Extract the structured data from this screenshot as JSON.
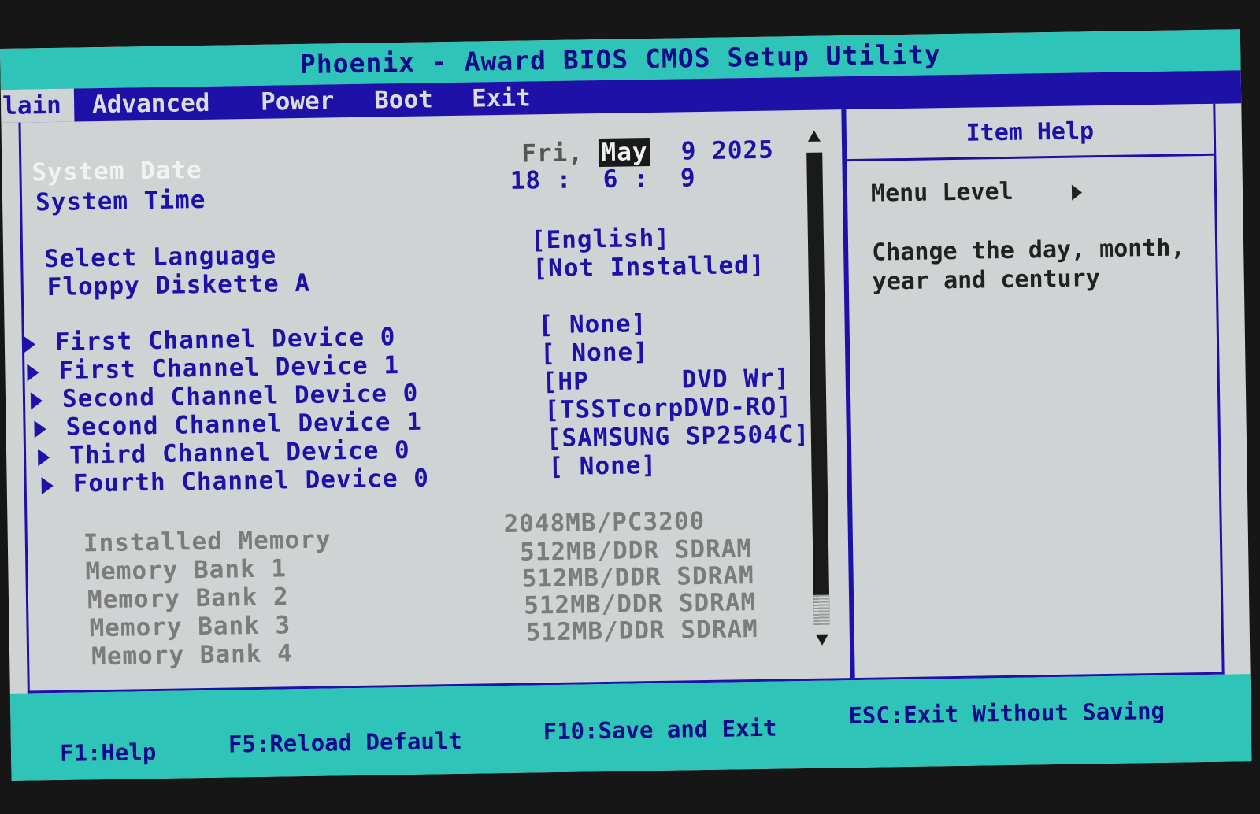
{
  "title": "Phoenix - Award BIOS CMOS Setup Utility",
  "menu": [
    "Main",
    "Advanced",
    "Power",
    "Boot",
    "Exit"
  ],
  "main_visible_label": "lain",
  "system_date": {
    "label": "System Date",
    "day": "Fri,",
    "month": "May",
    "date": "9",
    "year": "2025"
  },
  "system_time": {
    "label": "System Time",
    "value": "18 :  6 :  9"
  },
  "settings": [
    {
      "label": "Select Language",
      "value": "[English]"
    },
    {
      "label": "Floppy Diskette A",
      "value": "[Not Installed]"
    }
  ],
  "devices": [
    {
      "label": "First Channel Device 0",
      "value": "[ None]"
    },
    {
      "label": "First Channel Device 1",
      "value": "[ None]"
    },
    {
      "label": "Second Channel Device 0",
      "value": "[HP      DVD Wr]"
    },
    {
      "label": "Second Channel Device 1",
      "value": "[TSSTcorpDVD-RO]"
    },
    {
      "label": "Third Channel Device 0",
      "value": "[SAMSUNG SP2504C]"
    },
    {
      "label": "Fourth Channel Device 0",
      "value": "[ None]"
    }
  ],
  "memory": [
    {
      "label": "Installed Memory",
      "value": "2048MB/PC3200"
    },
    {
      "label": "Memory Bank 1",
      "value": "512MB/DDR SDRAM"
    },
    {
      "label": "Memory Bank 2",
      "value": "512MB/DDR SDRAM"
    },
    {
      "label": "Memory Bank 3",
      "value": "512MB/DDR SDRAM"
    },
    {
      "label": "Memory Bank 4",
      "value": "512MB/DDR SDRAM"
    }
  ],
  "help": {
    "title": "Item Help",
    "menu_level": "Menu Level",
    "text_line1": "Change the day, month,",
    "text_line2": "year and century"
  },
  "footer": {
    "f1": "F1:Help",
    "f5": "F5:Reload Default",
    "f10": "F10:Save and Exit",
    "esc": "ESC:Exit Without Saving"
  },
  "colors": {
    "bios_blue": "#1f10a8",
    "title_cyan": "#2fc4b8",
    "panel_gray": "#cfd3d4"
  }
}
